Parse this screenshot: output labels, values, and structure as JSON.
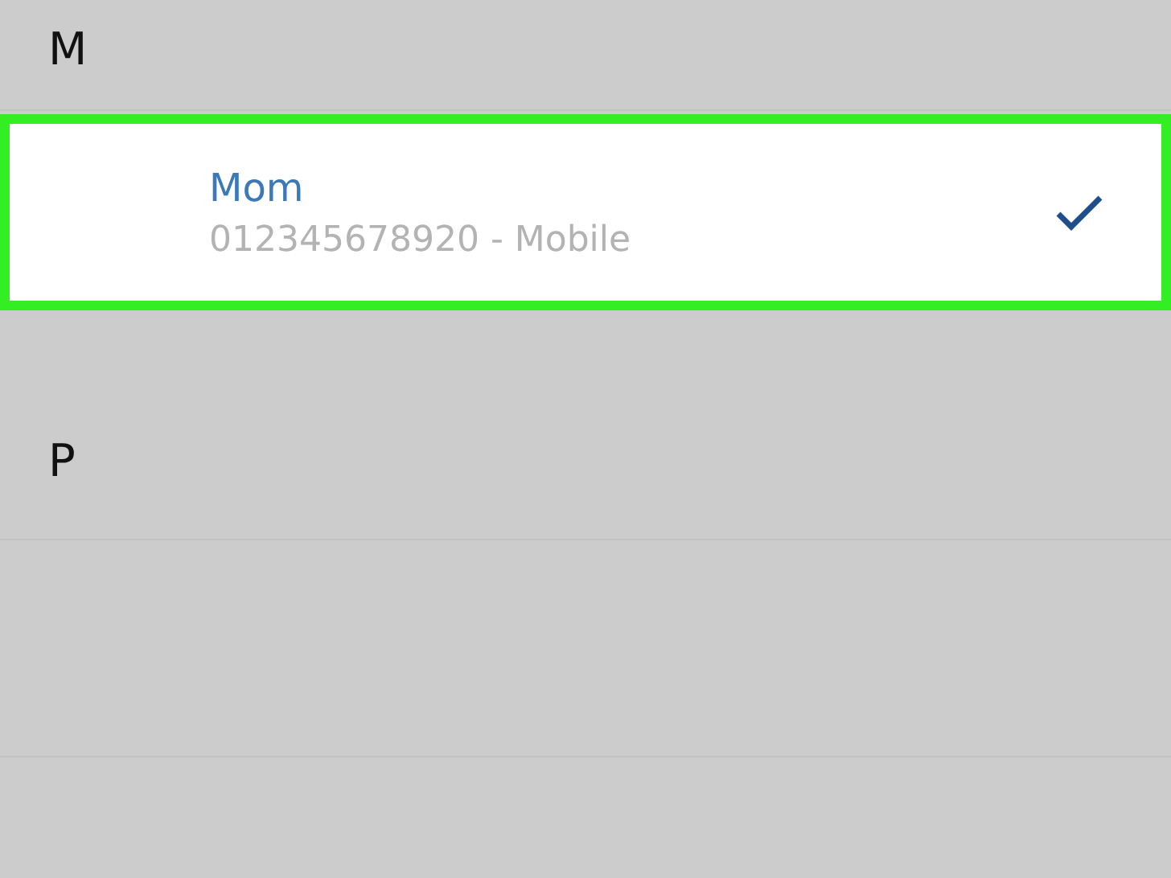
{
  "sections": [
    {
      "letter": "M",
      "contacts": [
        {
          "name": "Mom",
          "detail": "012345678920 - Mobile",
          "selected": true
        }
      ]
    },
    {
      "letter": "P"
    }
  ]
}
